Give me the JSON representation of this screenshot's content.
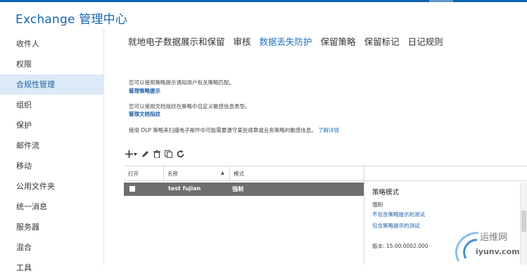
{
  "app": {
    "title": "Exchange 管理中心"
  },
  "sidebar": {
    "items": [
      {
        "label": "收件人"
      },
      {
        "label": "权限"
      },
      {
        "label": "合规性管理"
      },
      {
        "label": "组织"
      },
      {
        "label": "保护"
      },
      {
        "label": "邮件流"
      },
      {
        "label": "移动"
      },
      {
        "label": "公用文件夹"
      },
      {
        "label": "统一消息"
      },
      {
        "label": "服务器"
      },
      {
        "label": "混合"
      },
      {
        "label": "工具"
      }
    ]
  },
  "tabs": [
    {
      "label": "就地电子数据展示和保留"
    },
    {
      "label": "审核"
    },
    {
      "label": "数据丢失防护",
      "active": true
    },
    {
      "label": "保留策略"
    },
    {
      "label": "保留标记"
    },
    {
      "label": "日记规则"
    }
  ],
  "info": {
    "tips_text": "您可以使用策略提示通知用户有关策略匹配。",
    "tips_link": "管理策略提示",
    "fingerprint_text": "您可以使用文档指纹在策略中自定义敏感信息类型。",
    "fingerprint_link": "管理文档指纹",
    "dlp_text": "使用 DLP 策略来扫描电子邮件中可能需要遵守某些规章或业务策略的敏感信息。",
    "learn_more": "了解详情"
  },
  "toolbar": {
    "icons": [
      "add-icon",
      "dropdown-icon",
      "edit-icon",
      "delete-icon",
      "copy-icon",
      "refresh-icon"
    ]
  },
  "table": {
    "headers": {
      "enabled": "打开",
      "name": "名称",
      "mode": "模式"
    },
    "sort_indicator": "▲",
    "rows": [
      {
        "name": "test fujian",
        "mode": "强制",
        "selected": true
      }
    ]
  },
  "detail": {
    "title": "策略模式",
    "value": "强制",
    "link1": "不包含策略提示的测试",
    "link2": "包含策略提示的测试",
    "version": "版本: 15.00.0002.000"
  },
  "watermark": {
    "text": "运维网",
    "url": "iyunv.com"
  },
  "colors": {
    "accent": "#1f71c2",
    "brand": "#0a63b0",
    "selected_row": "#6e6e6e",
    "active_nav": "#dce9f7"
  }
}
